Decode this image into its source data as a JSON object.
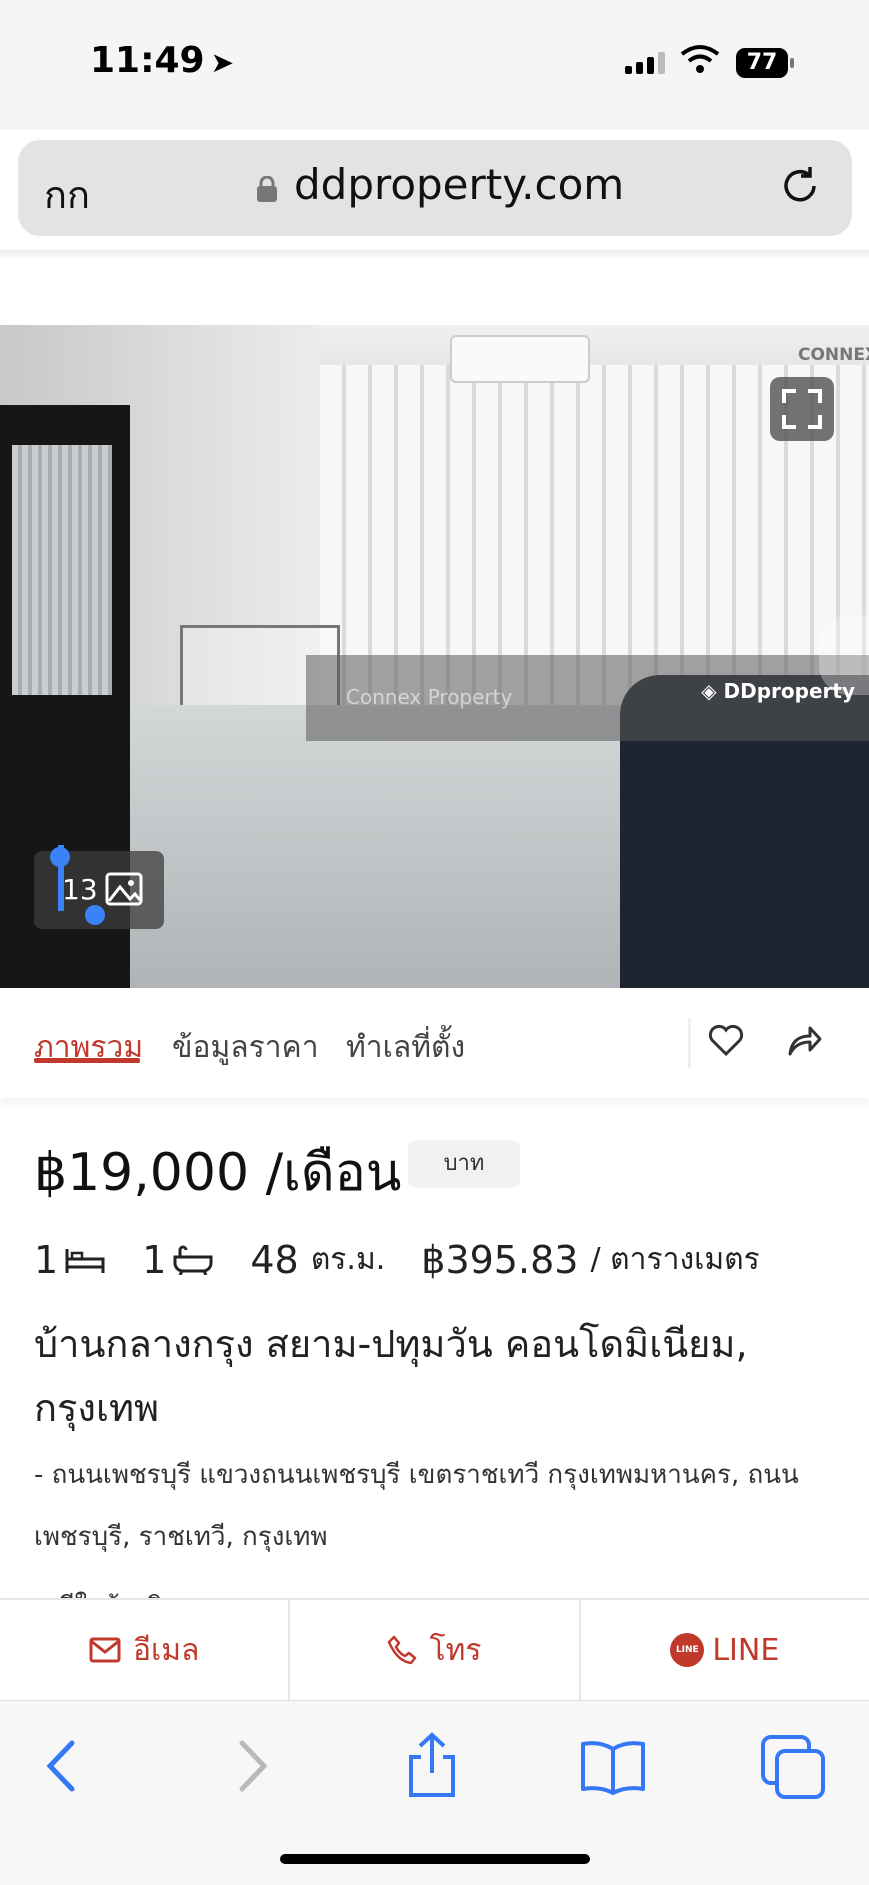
{
  "status_bar": {
    "time": "11:49",
    "battery": "77"
  },
  "browser": {
    "text_size_label": "กก",
    "url": "ddproperty.com"
  },
  "gallery": {
    "photo_count": "13",
    "watermark_agency": "Connex Property",
    "watermark_site": "DDproperty",
    "agency_logo_text": "CONNEX"
  },
  "tabs": [
    {
      "label": "ภาพรวม",
      "active": true
    },
    {
      "label": "ข้อมูลราคา",
      "active": false
    },
    {
      "label": "ทำเลที่ตั้ง",
      "active": false
    }
  ],
  "listing": {
    "price": "฿19,000 /เดือน",
    "currency_badge": "บาท",
    "bedrooms": "1",
    "bathrooms": "1",
    "area": "48",
    "area_unit": "ตร.ม.",
    "price_per_area": "฿395.83",
    "price_per_area_unit": "/ ตารางเมตร",
    "title": "บ้านกลางกรุง สยาม-ปทุมวัน คอนโดมิเนียม, กรุงเทพ",
    "address": "- ถนนเพชรบุรี แขวงถนนเพชรบุรี เขตราชเทวี กรุงเทพมหานคร, ถนนเพชรบุรี, ราชเทวี, กรุงเทพ",
    "next_line_partial": "• มีใบอ้างอิง"
  },
  "contact": {
    "email": "อีเมล",
    "call": "โทร",
    "line": "LINE"
  },
  "colors": {
    "accent": "#c0392b",
    "ios_blue": "#3478f6"
  }
}
